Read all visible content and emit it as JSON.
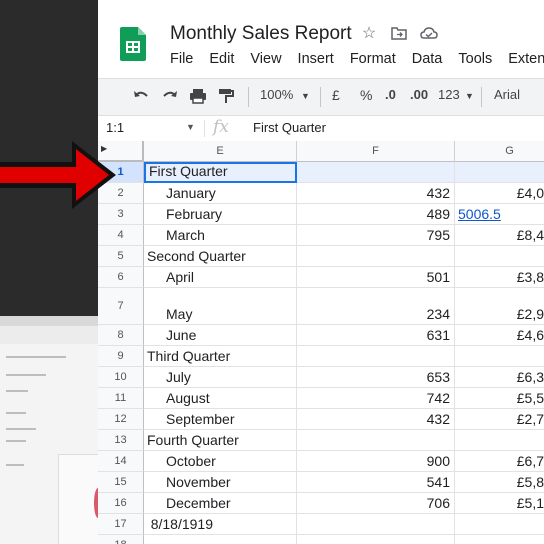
{
  "document": {
    "title": "Monthly Sales Report"
  },
  "menu": [
    "File",
    "Edit",
    "View",
    "Insert",
    "Format",
    "Data",
    "Tools",
    "Extens"
  ],
  "toolbar": {
    "zoom": "100%",
    "currency": "£",
    "percent": "%",
    "dec_decrease": ".0",
    "dec_increase": ".00",
    "more_formats": "123",
    "font": "Arial"
  },
  "formula_bar": {
    "name_box": "1:1",
    "fx": "fx",
    "content": "First Quarter"
  },
  "columns": [
    "E",
    "F",
    "G"
  ],
  "rows": [
    {
      "num": "1",
      "e": "First Quarter",
      "f": "",
      "g": ""
    },
    {
      "num": "2",
      "e": "January",
      "f": "432",
      "g": "£4,0"
    },
    {
      "num": "3",
      "e": "February",
      "f": "489",
      "g": "5006.5"
    },
    {
      "num": "4",
      "e": "March",
      "f": "795",
      "g": "£8,4"
    },
    {
      "num": "5",
      "e": "Second Quarter",
      "f": "",
      "g": ""
    },
    {
      "num": "6",
      "e": "April",
      "f": "501",
      "g": "£3,8"
    },
    {
      "num": "7",
      "e": "May",
      "f": "234",
      "g": "£2,9"
    },
    {
      "num": "8",
      "e": "June",
      "f": "631",
      "g": "£4,6"
    },
    {
      "num": "9",
      "e": "Third Quarter",
      "f": "",
      "g": ""
    },
    {
      "num": "10",
      "e": "July",
      "f": "653",
      "g": "£6,3"
    },
    {
      "num": "11",
      "e": "August",
      "f": "742",
      "g": "£5,5"
    },
    {
      "num": "12",
      "e": "September",
      "f": "432",
      "g": "£2,7"
    },
    {
      "num": "13",
      "e": "Fourth Quarter",
      "f": "",
      "g": ""
    },
    {
      "num": "14",
      "e": "October",
      "f": "900",
      "g": "£6,7"
    },
    {
      "num": "15",
      "e": "November",
      "f": "541",
      "g": "£5,8"
    },
    {
      "num": "16",
      "e": "December",
      "f": "706",
      "g": "£5,1"
    },
    {
      "num": "17",
      "e": "8/18/1919",
      "f": "",
      "g": ""
    },
    {
      "num": "18",
      "e": "",
      "f": "",
      "g": ""
    }
  ],
  "colors": {
    "arrow": "#e00000",
    "selection": "#1a73e8",
    "link": "#1155cc",
    "sheets_green": "#0f9d58"
  }
}
